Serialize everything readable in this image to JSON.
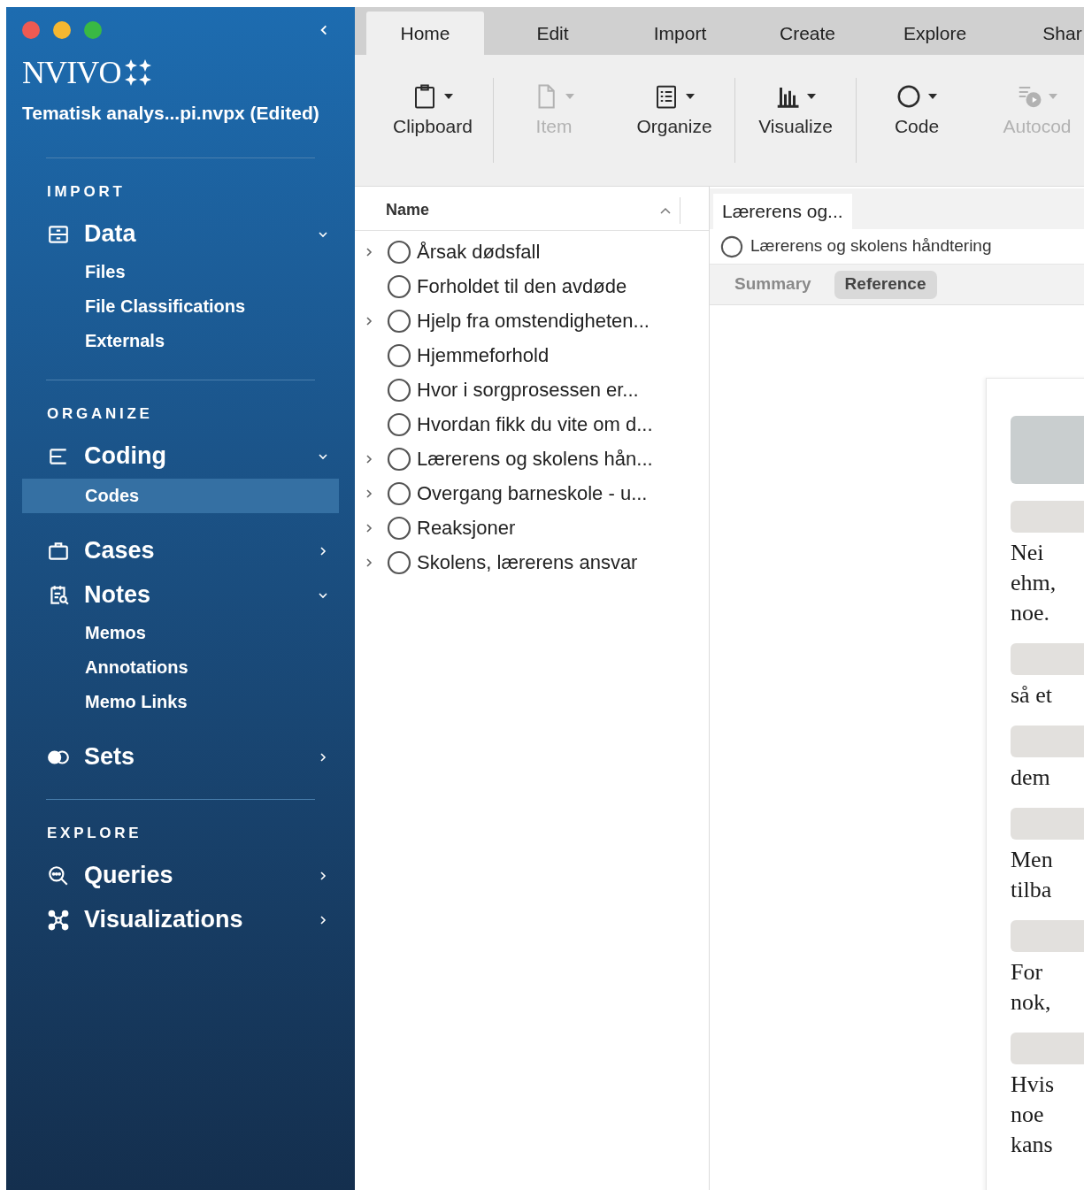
{
  "sidebar": {
    "app_name": "NVIVO",
    "project": "Tematisk analys...pi.nvpx (Edited)",
    "sections": [
      {
        "title": "IMPORT",
        "groups": [
          {
            "label": "Data",
            "expanded": true,
            "children": [
              {
                "label": "Files",
                "selected": false
              },
              {
                "label": "File Classifications",
                "selected": false
              },
              {
                "label": "Externals",
                "selected": false
              }
            ]
          }
        ]
      },
      {
        "title": "ORGANIZE",
        "groups": [
          {
            "label": "Coding",
            "expanded": true,
            "children": [
              {
                "label": "Codes",
                "selected": true
              }
            ]
          },
          {
            "label": "Cases",
            "expanded": false
          },
          {
            "label": "Notes",
            "expanded": true,
            "children": [
              {
                "label": "Memos",
                "selected": false
              },
              {
                "label": "Annotations",
                "selected": false
              },
              {
                "label": "Memo Links",
                "selected": false
              }
            ]
          },
          {
            "label": "Sets",
            "expanded": false
          }
        ]
      },
      {
        "title": "EXPLORE",
        "groups": [
          {
            "label": "Queries",
            "expanded": false
          },
          {
            "label": "Visualizations",
            "expanded": false
          }
        ]
      }
    ]
  },
  "ribbon_tabs": [
    {
      "label": "Home",
      "selected": true
    },
    {
      "label": "Edit",
      "selected": false
    },
    {
      "label": "Import",
      "selected": false
    },
    {
      "label": "Create",
      "selected": false
    },
    {
      "label": "Explore",
      "selected": false
    },
    {
      "label": "Shar",
      "selected": false
    }
  ],
  "toolbar_groups": [
    [
      {
        "label": "Clipboard",
        "disabled": false
      }
    ],
    [
      {
        "label": "Item",
        "disabled": true
      },
      {
        "label": "Organize",
        "disabled": false
      }
    ],
    [
      {
        "label": "Visualize",
        "disabled": false
      }
    ],
    [
      {
        "label": "Code",
        "disabled": false
      },
      {
        "label": "Autocod",
        "disabled": true
      }
    ]
  ],
  "code_list": {
    "column": "Name",
    "items": [
      {
        "name": "Årsak dødsfall",
        "expandable": true
      },
      {
        "name": "Forholdet til den avdøde",
        "expandable": false
      },
      {
        "name": "Hjelp fra omstendigheten...",
        "expandable": true
      },
      {
        "name": "Hjemmeforhold",
        "expandable": false
      },
      {
        "name": "Hvor i sorgprosessen er...",
        "expandable": false
      },
      {
        "name": "Hvordan fikk du vite om d...",
        "expandable": false
      },
      {
        "name": "Lærerens og skolens hån...",
        "expandable": true
      },
      {
        "name": "Overgang barneskole - u...",
        "expandable": true
      },
      {
        "name": "Reaksjoner",
        "expandable": true
      },
      {
        "name": "Skolens, lærerens ansvar",
        "expandable": true
      }
    ]
  },
  "detail": {
    "tab": "Lærerens og...",
    "code_name": "Lærerens og skolens håndtering",
    "view_tabs": [
      {
        "label": "Summary",
        "selected": false
      },
      {
        "label": "Reference",
        "selected": true
      }
    ],
    "document": [
      [
        "Nei",
        "ehm,",
        "noe."
      ],
      [
        "så et"
      ],
      [
        "dem"
      ],
      [
        "Men",
        "tilba"
      ],
      [
        "For",
        "nok,"
      ],
      [
        "Hvis",
        "noe",
        "kans"
      ]
    ]
  }
}
